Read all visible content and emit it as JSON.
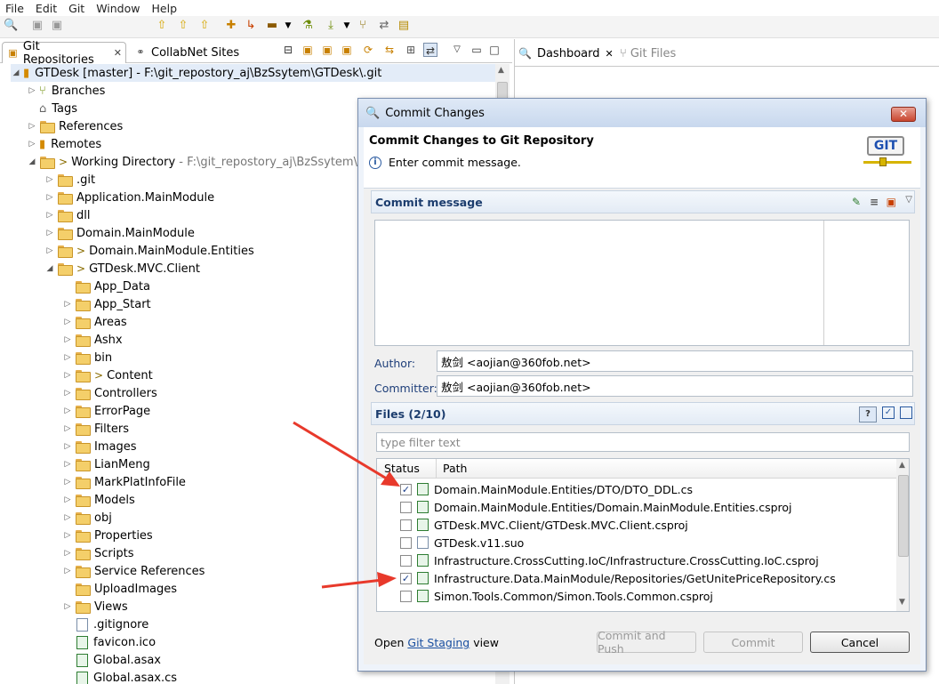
{
  "menu": [
    "File",
    "Edit",
    "Git",
    "Window",
    "Help"
  ],
  "left_tabs": [
    {
      "label": "Git Repositories",
      "close": "✕"
    },
    {
      "label": "CollabNet Sites"
    }
  ],
  "right_tabs": [
    {
      "label": "Dashboard",
      "close": "✕"
    },
    {
      "label": "Git Files"
    }
  ],
  "tree": {
    "repo": {
      "name": "GTDesk [master]",
      "path": "- F:\\git_repostory_aj\\BzSsytem\\GTDesk\\.git"
    },
    "top_items": [
      "Branches",
      "Tags",
      "References",
      "Remotes"
    ],
    "working_dir": {
      "label": "Working Directory",
      "path": "- F:\\git_repostory_aj\\BzSsytem\\GTDes"
    },
    "wd_items": [
      ".git",
      "Application.MainModule",
      "dll",
      "Domain.MainModule",
      "Domain.MainModule.Entities",
      "GTDesk.MVC.Client"
    ],
    "client_items": [
      "App_Data",
      "App_Start",
      "Areas",
      "Ashx",
      "bin",
      "Content",
      "Controllers",
      "ErrorPage",
      "Filters",
      "Images",
      "LianMeng",
      "MarkPlatInfoFile",
      "Models",
      "obj",
      "Properties",
      "Scripts",
      "Service References",
      "UploadImages",
      "Views"
    ],
    "client_files": [
      ".gitignore",
      "favicon.ico",
      "Global.asax",
      "Global.asax.cs"
    ]
  },
  "dialog": {
    "title": "Commit Changes",
    "heading": "Commit Changes to Git Repository",
    "info": "Enter commit message.",
    "logo_text": "GIT",
    "commit_message_header": "Commit message",
    "commit_message_value": "",
    "author_label": "Author:",
    "author_value": "敖剑 <aojian@360fob.net>",
    "committer_label": "Committer:",
    "committer_value": "敖剑 <aojian@360fob.net>",
    "files_header": "Files (2/10)",
    "filter_placeholder": "type filter text",
    "col_status": "Status",
    "col_path": "Path",
    "files": [
      {
        "checked": true,
        "path": "Domain.MainModule.Entities/DTO/DTO_DDL.cs"
      },
      {
        "checked": false,
        "path": "Domain.MainModule.Entities/Domain.MainModule.Entities.csproj"
      },
      {
        "checked": false,
        "path": "GTDesk.MVC.Client/GTDesk.MVC.Client.csproj"
      },
      {
        "checked": false,
        "path": "GTDesk.v11.suo"
      },
      {
        "checked": false,
        "path": "Infrastructure.CrossCutting.IoC/Infrastructure.CrossCutting.IoC.csproj"
      },
      {
        "checked": true,
        "path": "Infrastructure.Data.MainModule/Repositories/GetUnitePriceRepository.cs"
      },
      {
        "checked": false,
        "path": "Simon.Tools.Common/Simon.Tools.Common.csproj"
      }
    ],
    "open_prefix": "Open",
    "open_link": "Git Staging",
    "open_suffix": "view",
    "btn_commit_push": "Commit and Push",
    "btn_commit": "Commit",
    "btn_cancel": "Cancel"
  },
  "colors": {
    "accent": "#1c3d6e",
    "arrow": "#e8392b",
    "link": "#1a4fa0"
  }
}
